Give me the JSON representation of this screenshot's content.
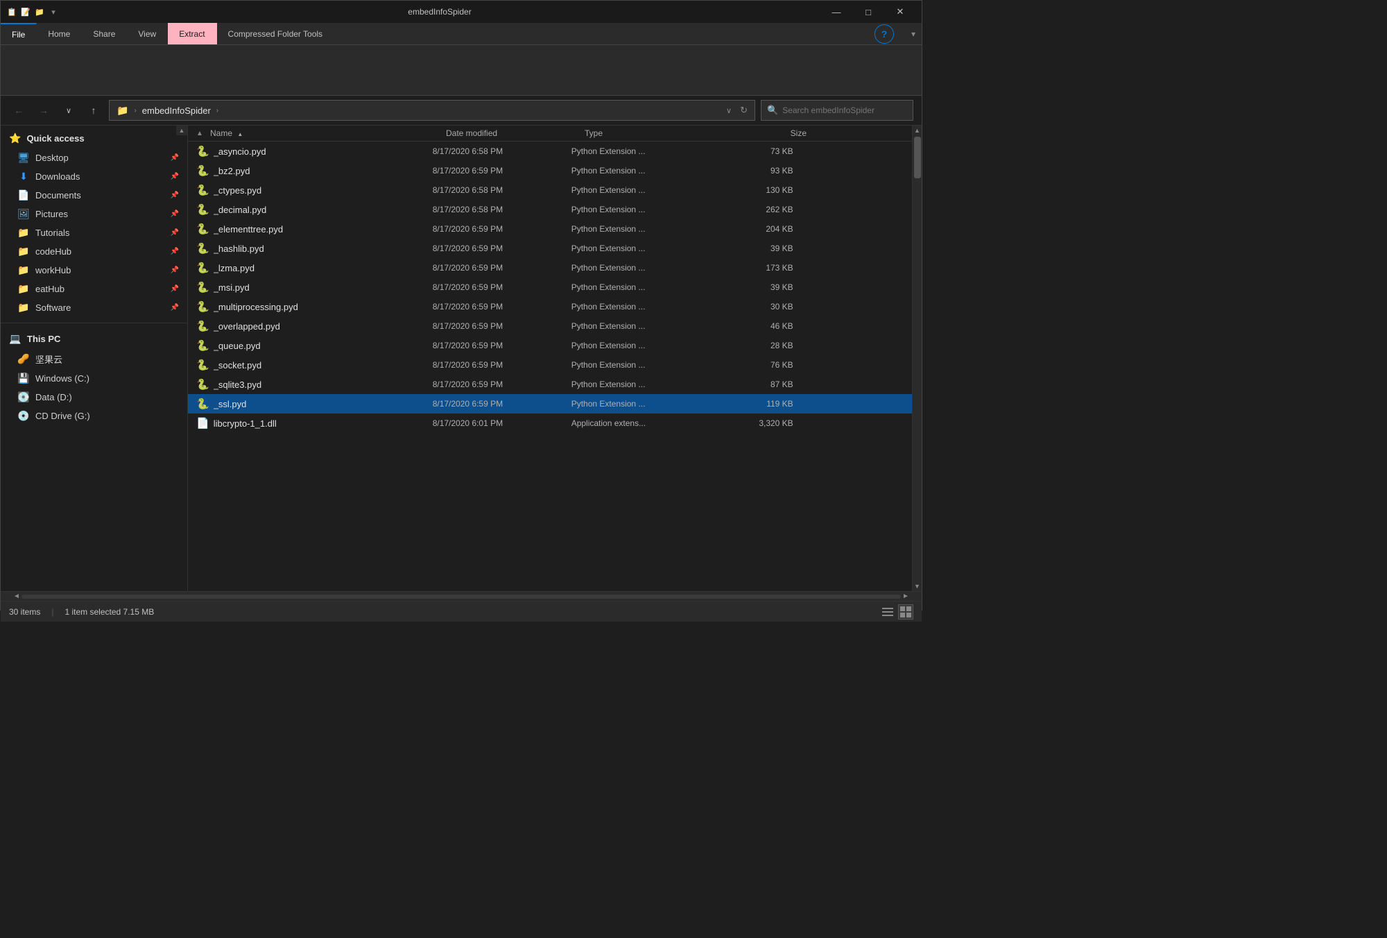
{
  "titleBar": {
    "title": "embedInfoSpider",
    "icons": [
      "📋",
      "📝",
      "🗂"
    ],
    "minBtn": "—",
    "maxBtn": "□",
    "closeBtn": "✕"
  },
  "ribbon": {
    "tabs": [
      {
        "label": "File",
        "active": false
      },
      {
        "label": "Home",
        "active": false
      },
      {
        "label": "Share",
        "active": false
      },
      {
        "label": "View",
        "active": false
      },
      {
        "label": "Extract",
        "active": true,
        "highlighted": true
      },
      {
        "label": "Compressed Folder Tools",
        "active": false
      }
    ],
    "helpIcon": "?"
  },
  "addressBar": {
    "backBtn": "←",
    "forwardBtn": "→",
    "downBtn": "∨",
    "upBtn": "↑",
    "path": "embedInfoSpider",
    "searchPlaceholder": "Search embedInfoSpider",
    "refreshBtn": "↻",
    "dropBtn": "∨"
  },
  "sidebar": {
    "quickAccess": "Quick access",
    "items": [
      {
        "label": "Desktop",
        "iconType": "desktop",
        "pinned": true
      },
      {
        "label": "Downloads",
        "iconType": "downloads",
        "pinned": true
      },
      {
        "label": "Documents",
        "iconType": "docs",
        "pinned": true
      },
      {
        "label": "Pictures",
        "iconType": "pics",
        "pinned": true
      },
      {
        "label": "Tutorials",
        "iconType": "folder",
        "pinned": true
      },
      {
        "label": "codeHub",
        "iconType": "folder",
        "pinned": true
      },
      {
        "label": "workHub",
        "iconType": "folder",
        "pinned": true
      },
      {
        "label": "eatHub",
        "iconType": "folder",
        "pinned": true
      },
      {
        "label": "Software",
        "iconType": "folder",
        "pinned": true
      }
    ],
    "thisPC": "This PC",
    "drives": [
      {
        "label": "坚果云",
        "iconType": "jianguoyun"
      },
      {
        "label": "Windows (C:)",
        "iconType": "windows"
      },
      {
        "label": "Data (D:)",
        "iconType": "data"
      },
      {
        "label": "CD Drive (G:)",
        "iconType": "cd"
      }
    ]
  },
  "fileList": {
    "columns": [
      {
        "label": "Name",
        "sortIcon": "↑"
      },
      {
        "label": "Date modified"
      },
      {
        "label": "Type"
      },
      {
        "label": "Size"
      }
    ],
    "files": [
      {
        "name": "_asyncio.pyd",
        "date": "8/17/2020 6:58 PM",
        "type": "Python Extension ...",
        "size": "73 KB",
        "selected": false
      },
      {
        "name": "_bz2.pyd",
        "date": "8/17/2020 6:59 PM",
        "type": "Python Extension ...",
        "size": "93 KB",
        "selected": false
      },
      {
        "name": "_ctypes.pyd",
        "date": "8/17/2020 6:58 PM",
        "type": "Python Extension ...",
        "size": "130 KB",
        "selected": false
      },
      {
        "name": "_decimal.pyd",
        "date": "8/17/2020 6:58 PM",
        "type": "Python Extension ...",
        "size": "262 KB",
        "selected": false
      },
      {
        "name": "_elementtree.pyd",
        "date": "8/17/2020 6:59 PM",
        "type": "Python Extension ...",
        "size": "204 KB",
        "selected": false
      },
      {
        "name": "_hashlib.pyd",
        "date": "8/17/2020 6:59 PM",
        "type": "Python Extension ...",
        "size": "39 KB",
        "selected": false
      },
      {
        "name": "_lzma.pyd",
        "date": "8/17/2020 6:59 PM",
        "type": "Python Extension ...",
        "size": "173 KB",
        "selected": false
      },
      {
        "name": "_msi.pyd",
        "date": "8/17/2020 6:59 PM",
        "type": "Python Extension ...",
        "size": "39 KB",
        "selected": false
      },
      {
        "name": "_multiprocessing.pyd",
        "date": "8/17/2020 6:59 PM",
        "type": "Python Extension ...",
        "size": "30 KB",
        "selected": false
      },
      {
        "name": "_overlapped.pyd",
        "date": "8/17/2020 6:59 PM",
        "type": "Python Extension ...",
        "size": "46 KB",
        "selected": false
      },
      {
        "name": "_queue.pyd",
        "date": "8/17/2020 6:59 PM",
        "type": "Python Extension ...",
        "size": "28 KB",
        "selected": false
      },
      {
        "name": "_socket.pyd",
        "date": "8/17/2020 6:59 PM",
        "type": "Python Extension ...",
        "size": "76 KB",
        "selected": false
      },
      {
        "name": "_sqlite3.pyd",
        "date": "8/17/2020 6:59 PM",
        "type": "Python Extension ...",
        "size": "87 KB",
        "selected": false
      },
      {
        "name": "_ssl.pyd",
        "date": "8/17/2020 6:59 PM",
        "type": "Python Extension ...",
        "size": "119 KB",
        "selected": true
      },
      {
        "name": "libcrypto-1_1.dll",
        "date": "8/17/2020 6:01 PM",
        "type": "Application extens...",
        "size": "3,320 KB",
        "selected": false
      }
    ]
  },
  "statusBar": {
    "itemCount": "30 items",
    "sep": "|",
    "selected": "1 item selected  7.15 MB",
    "sep2": "|",
    "listViewLabel": "☰",
    "detailViewLabel": "⊞"
  }
}
